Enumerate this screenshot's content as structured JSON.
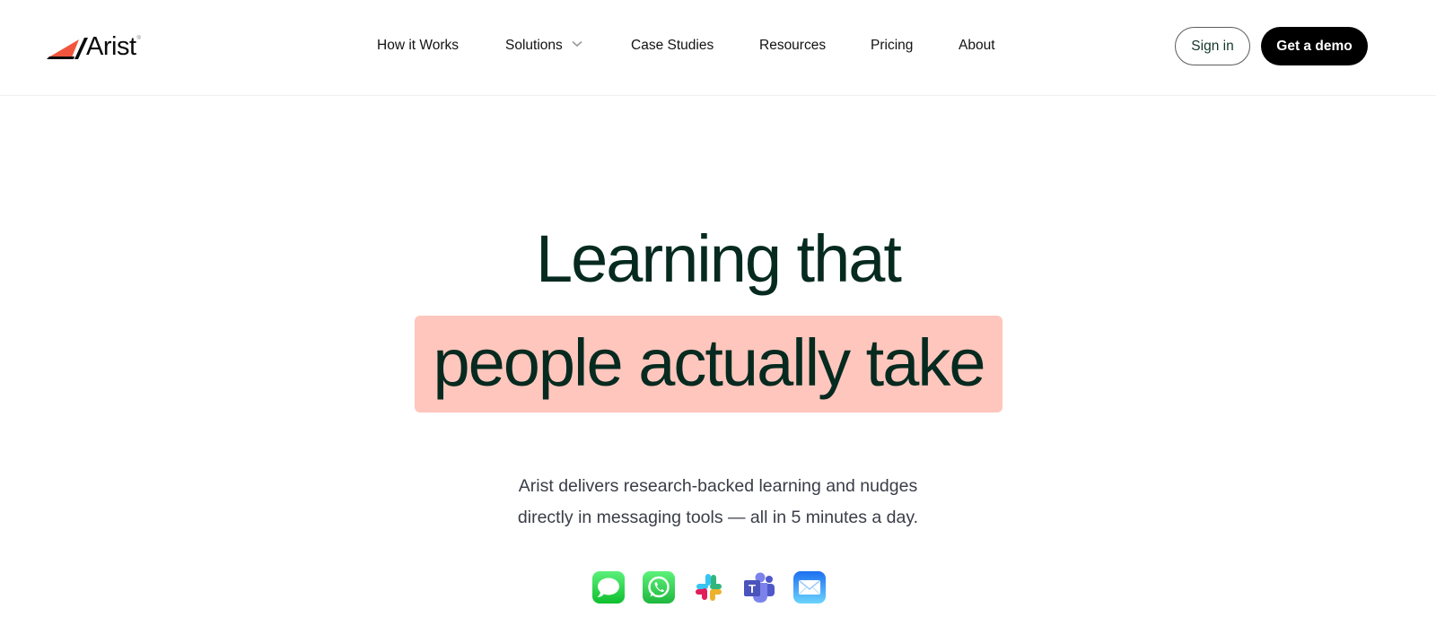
{
  "brand": {
    "name": "Arist",
    "registered_mark": "®",
    "accent_color": "#f2553d"
  },
  "nav": {
    "links": [
      {
        "label": "How it Works"
      },
      {
        "label": "Solutions",
        "has_dropdown": true
      },
      {
        "label": "Case Studies"
      },
      {
        "label": "Resources"
      },
      {
        "label": "Pricing"
      },
      {
        "label": "About"
      }
    ],
    "sign_in_label": "Sign in",
    "demo_label": "Get a demo"
  },
  "hero": {
    "line1": "Learning that",
    "line2": "people actually take",
    "highlight_color": "#ffc6bd",
    "text_color": "#062a1f",
    "subtitle_line1": "Arist delivers research-backed learning and nudges",
    "subtitle_line2": "directly in messaging tools — all in 5 minutes a day."
  },
  "messaging_apps": [
    {
      "name": "iMessage",
      "icon": "imessage-icon"
    },
    {
      "name": "WhatsApp",
      "icon": "whatsapp-icon"
    },
    {
      "name": "Slack",
      "icon": "slack-icon"
    },
    {
      "name": "Microsoft Teams",
      "icon": "teams-icon"
    },
    {
      "name": "Mail",
      "icon": "mail-icon"
    }
  ]
}
